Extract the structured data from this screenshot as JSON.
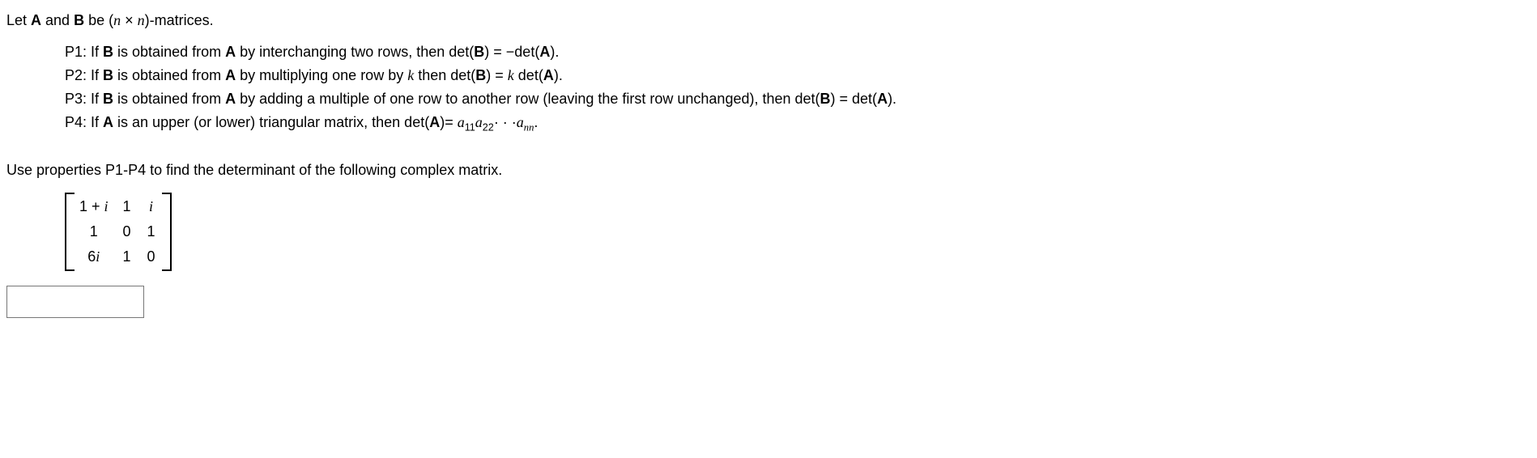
{
  "intro": {
    "prefix": "Let ",
    "A": "A",
    "and": " and ",
    "B": "B",
    "be": " be (",
    "n1": "n",
    "times": " × ",
    "n2": "n",
    "suffix": ")-matrices."
  },
  "p1": {
    "label": "P1: If ",
    "B": "B",
    "mid1": " is obtained from ",
    "A": "A",
    "mid2": " by interchanging two rows, then  det(",
    "B2": "B",
    "mid3": ") = −det(",
    "A2": "A",
    "end": ")."
  },
  "p2": {
    "label": "P2: If ",
    "B": "B",
    "mid1": " is obtained from ",
    "A": "A",
    "mid2": " by multiplying one row by ",
    "k": "k",
    "mid3": " then  det(",
    "B2": "B",
    "mid4": ") = ",
    "k2": "k",
    "mid5": " det(",
    "A2": "A",
    "end": ")."
  },
  "p3": {
    "label": "P3: If ",
    "B": "B",
    "mid1": " is obtained from ",
    "A": "A",
    "mid2": " by adding a multiple of one row to another row (leaving the first row unchanged), then  det(",
    "B2": "B",
    "mid3": ") = det(",
    "A2": "A",
    "end": ")."
  },
  "p4": {
    "label": "P4: If ",
    "A": "A",
    "mid1": " is an upper (or lower) triangular matrix, then  det(",
    "A2": "A",
    "mid2": ")= ",
    "a1": "a",
    "s11": "11",
    "a2": "a",
    "s22": "22",
    "dots": "· · ·",
    "a3": "a",
    "snn": "nn",
    "end": "."
  },
  "question": "Use properties P1-P4 to find the determinant of the following complex matrix.",
  "matrix": {
    "r0c0a": "1 + ",
    "r0c0b": "i",
    "r0c1": "1",
    "r0c2": "i",
    "r1c0": "1",
    "r1c1": "0",
    "r1c2": "1",
    "r2c0a": "6",
    "r2c0b": "i",
    "r2c1": "1",
    "r2c2": "0"
  },
  "answer": ""
}
